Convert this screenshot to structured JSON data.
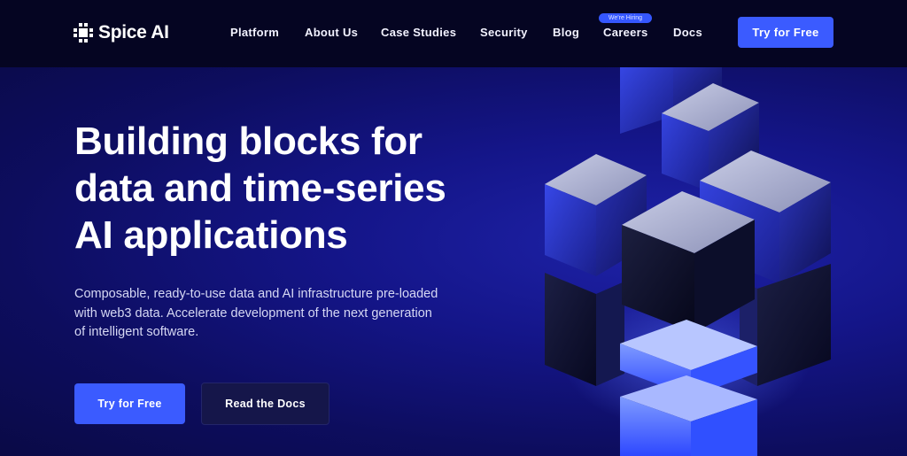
{
  "brand": {
    "name": "Spice AI",
    "logo_icon": "spice-ai-logo-icon"
  },
  "nav": {
    "items": [
      {
        "label": "Platform"
      },
      {
        "label": "About Us"
      },
      {
        "label": "Case Studies"
      },
      {
        "label": "Security"
      },
      {
        "label": "Blog"
      },
      {
        "label": "Careers",
        "badge": "We're Hiring"
      },
      {
        "label": "Docs"
      }
    ],
    "cta_label": "Try for Free"
  },
  "hero": {
    "headline_lines": [
      "Building blocks for",
      "data and time-series",
      "AI applications"
    ],
    "subtext_lines": [
      "Composable, ready-to-use data and AI infrastructure pre-loaded",
      "with web3 data. Accelerate development of the next generation",
      "of intelligent software."
    ],
    "primary_button": "Try for Free",
    "secondary_button": "Read the Docs",
    "illustration": "glass-cubes-illustration"
  },
  "colors": {
    "topbar_bg": "#050522",
    "hero_bg": "#141588",
    "accent": "#3b5bff",
    "secondary_button_bg": "#15164a",
    "cube_glow": "#4a6bff"
  }
}
